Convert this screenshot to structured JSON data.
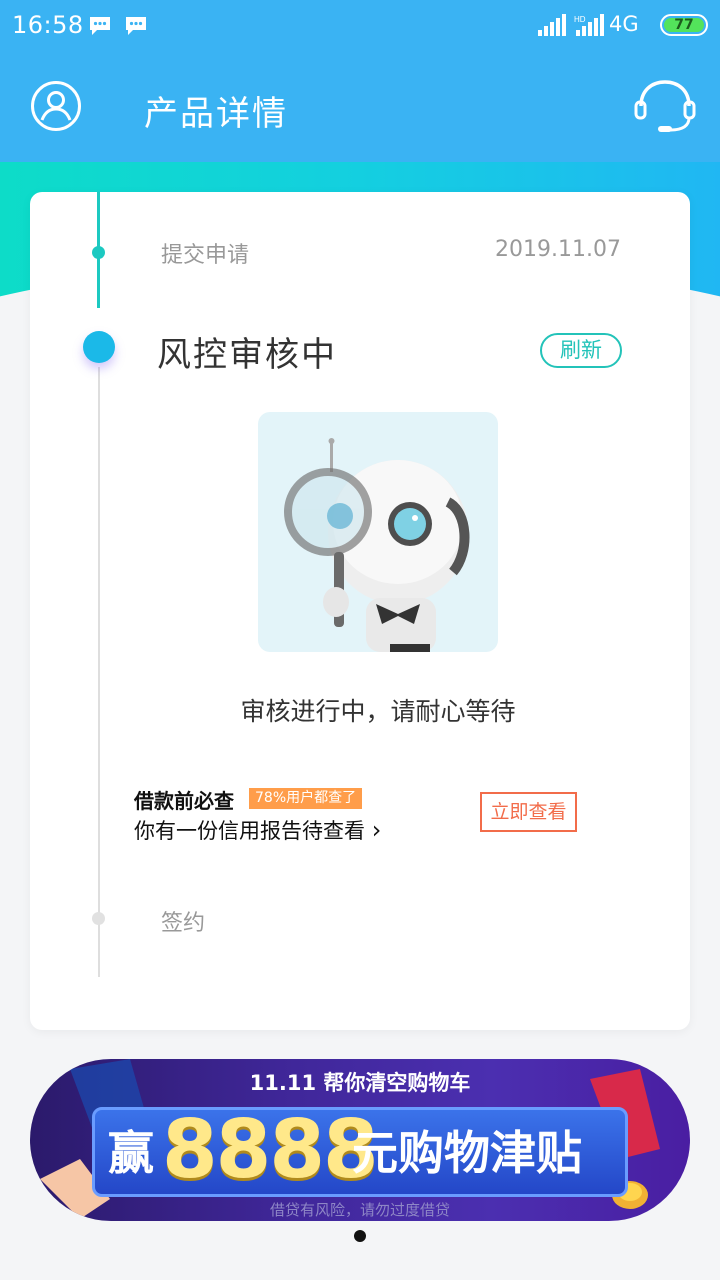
{
  "status_bar": {
    "time": "16:58",
    "network": "4G",
    "battery": "77"
  },
  "header": {
    "title": "产品详情"
  },
  "timeline": {
    "step1": {
      "label": "提交申请",
      "date": "2019.11.07"
    },
    "step2": {
      "label": "风控审核中",
      "refresh": "刷新"
    },
    "review_text": "审核进行中，请耐心等待",
    "step3": {
      "label": "签约"
    }
  },
  "credit": {
    "title": "借款前必查",
    "badge": "78%用户都查了",
    "desc": "你有一份信用报告待查看",
    "chevron": "›",
    "button": "立即查看"
  },
  "banner": {
    "top_text": "11.11 帮你清空购物车",
    "win": "赢",
    "amount": "8888",
    "subsidy": "元购物津贴",
    "risk": "借贷有风险，请勿过度借贷"
  },
  "colors": {
    "header_bg": "#3ab3f3",
    "accent_teal": "#1cc9c1",
    "accent_orange": "#f26c4a"
  }
}
